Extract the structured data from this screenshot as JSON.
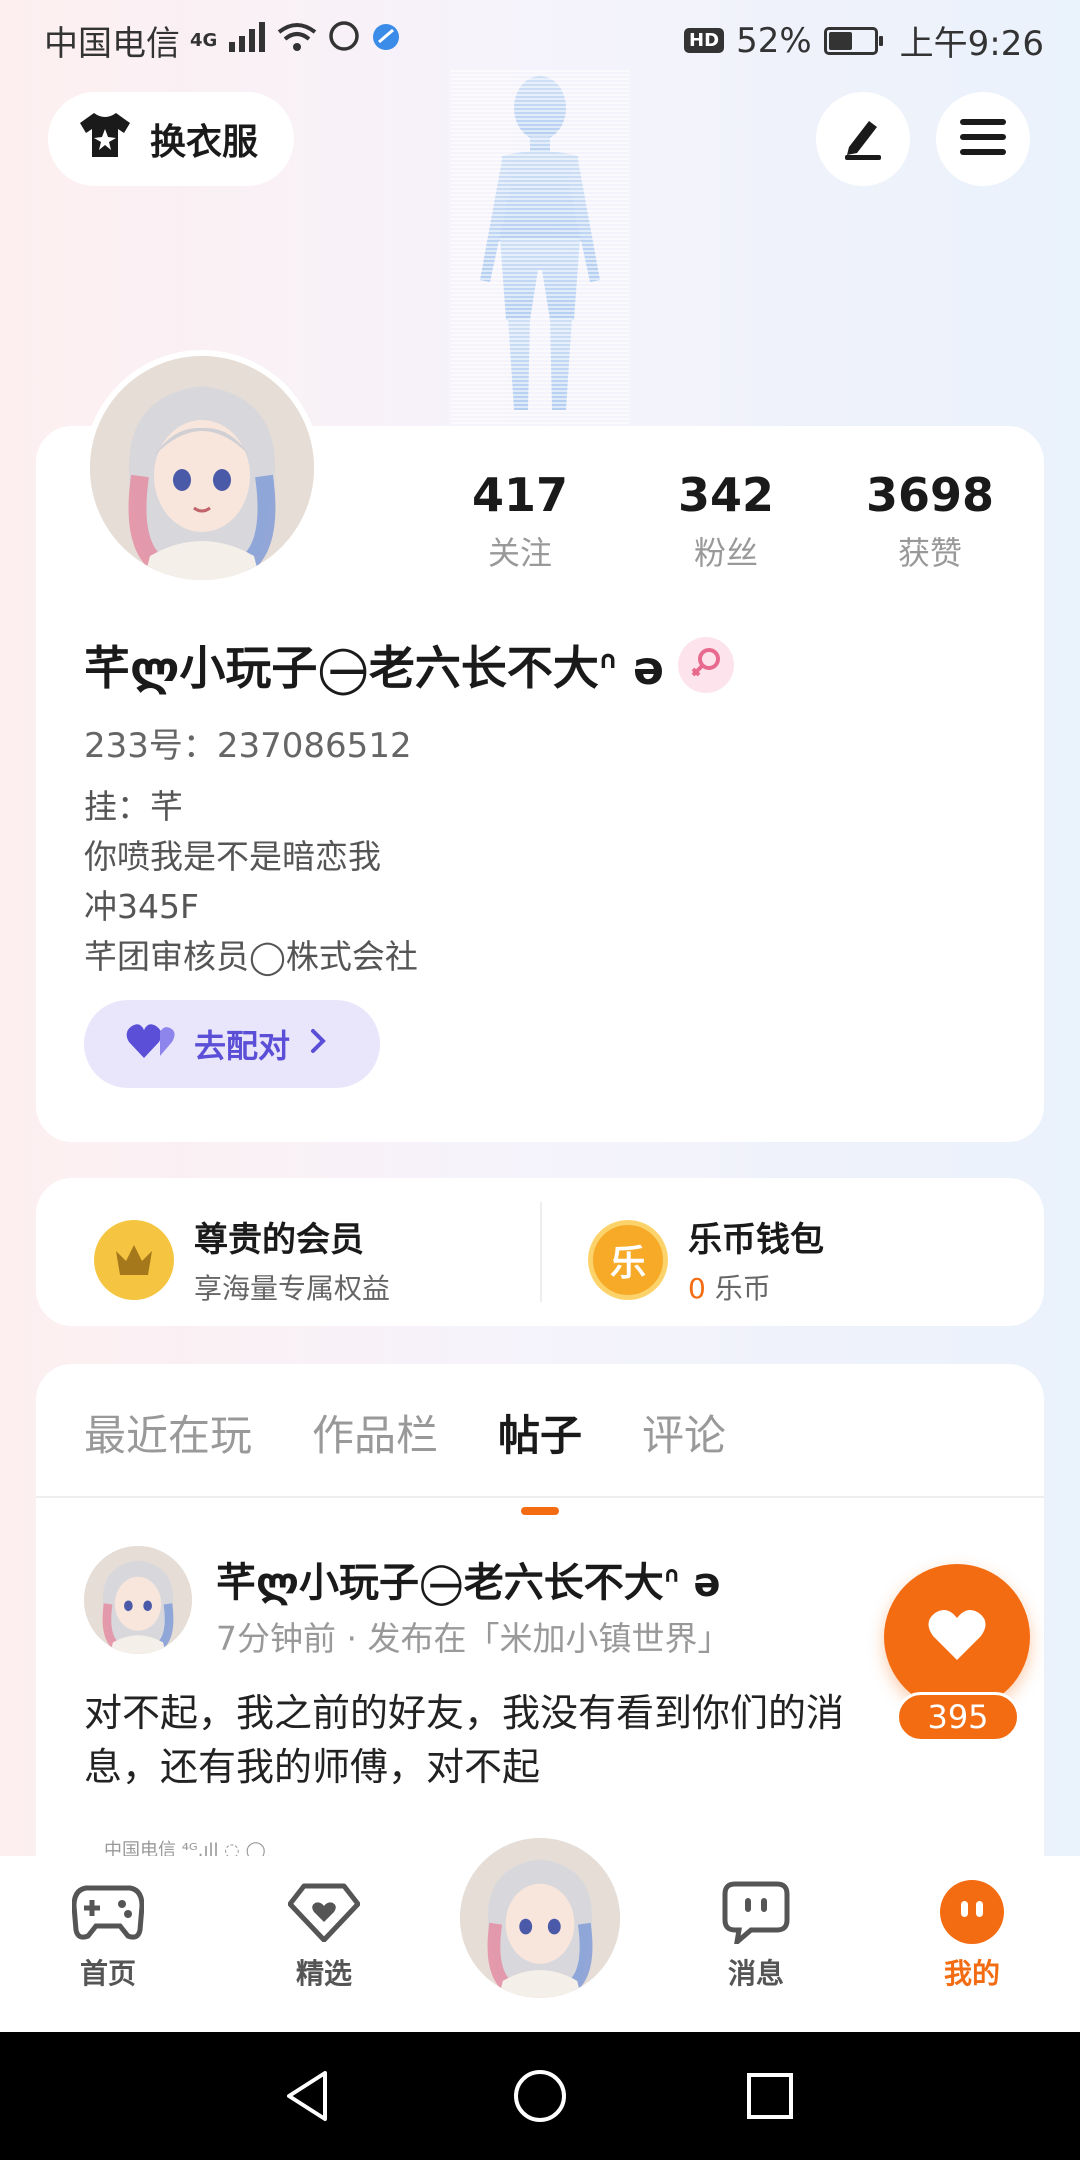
{
  "status_bar": {
    "carrier": "中国电信",
    "network": "4G",
    "battery_percent": "52%",
    "battery_level": 0.52,
    "time": "上午9:26",
    "hd": "HD"
  },
  "top_bar": {
    "change_clothes_label": "换衣服"
  },
  "profile": {
    "nickname": "芊ლ小玩子◯̶老六长不大ᐢ ə",
    "uid": "233号：237086512",
    "bio": [
      "挂：芊",
      "你喷我是不是暗恋我",
      "冲345F",
      "芊团审核员◯株式会社"
    ],
    "stats": [
      {
        "value": "417",
        "label": "关注"
      },
      {
        "value": "342",
        "label": "粉丝"
      },
      {
        "value": "3698",
        "label": "获赞"
      }
    ],
    "pair_button": "去配对"
  },
  "membership": {
    "vip_title": "尊贵的会员",
    "vip_sub": "享海量专属权益",
    "wallet_title": "乐币钱包",
    "wallet_amount": "0",
    "wallet_unit": "乐币",
    "wallet_coin_char": "乐"
  },
  "tabs": [
    {
      "label": "最近在玩",
      "active": false
    },
    {
      "label": "作品栏",
      "active": false
    },
    {
      "label": "帖子",
      "active": true
    },
    {
      "label": "评论",
      "active": false
    }
  ],
  "post": {
    "author": "芊ლ小玩子◯̶老六长不大ᐢ ə",
    "meta": "7分钟前 · 发布在「米加小镇世界」",
    "text": "对不起，我之前的好友，我没有看到你们的消息，还有我的师傅，对不起",
    "thumb_text": "中国电信 ⁴ᴳ.ıll ◌ ◯"
  },
  "like": {
    "count": "395"
  },
  "bottom_nav": [
    {
      "label": "首页",
      "icon": "gamepad-icon",
      "active": false
    },
    {
      "label": "精选",
      "icon": "heart-gem-icon",
      "active": false
    },
    {
      "label": "消息",
      "icon": "chat-bubble-icon",
      "active": false
    },
    {
      "label": "我的",
      "icon": "face-icon",
      "active": true
    }
  ],
  "colors": {
    "accent": "#f36c12",
    "pair_purple": "#5a4fd6",
    "vip_gold": "#f5c542"
  }
}
